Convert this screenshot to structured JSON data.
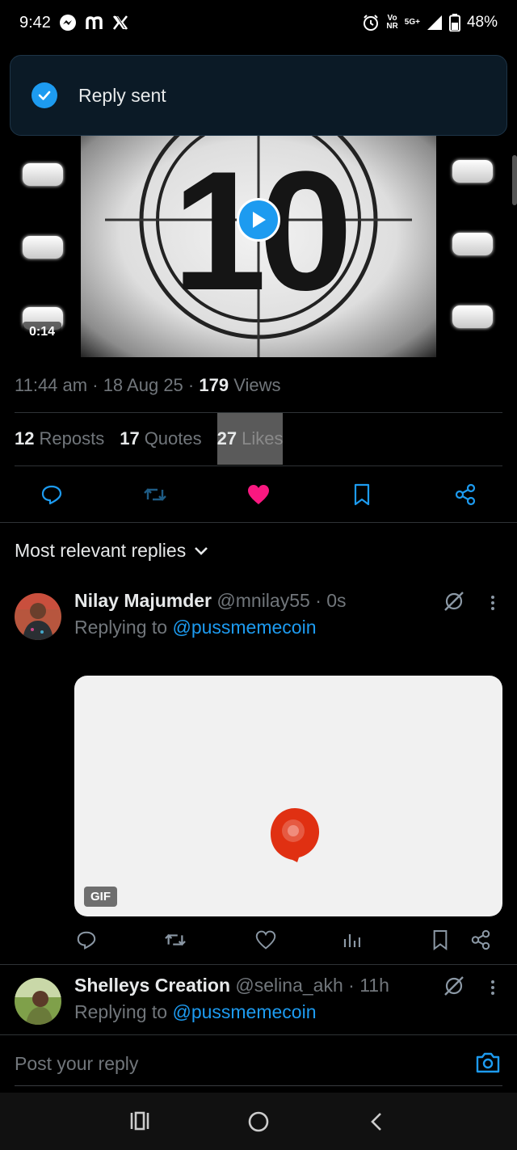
{
  "status_bar": {
    "time": "9:42",
    "battery": "48%",
    "net_top": "Vo",
    "net_bottom": "NR",
    "signal": "5G+"
  },
  "toast": {
    "text": "Reply sent"
  },
  "video": {
    "duration": "0:14",
    "countdown_digit": "10"
  },
  "post_meta": {
    "time": "11:44 am",
    "date": "18 Aug 25",
    "views_count": "179",
    "views_label": "Views",
    "separator": "·"
  },
  "stats": {
    "reposts_count": "12",
    "reposts_label": "Reposts",
    "quotes_count": "17",
    "quotes_label": "Quotes",
    "likes_count": "27",
    "likes_label": "Likes"
  },
  "sort": {
    "label": "Most relevant replies"
  },
  "replies": [
    {
      "name": "Nilay Majumder",
      "handle": "@mnilay55",
      "time": "0s",
      "replying_label": "Replying to",
      "replying_to": "@pussmemecoin",
      "media_badge": "GIF"
    },
    {
      "name": "Shelleys Creation",
      "handle": "@selina_akh",
      "time": "11h",
      "replying_label": "Replying to",
      "replying_to": "@pussmemecoin"
    }
  ],
  "compose": {
    "placeholder": "Post your reply"
  },
  "colors": {
    "accent": "#1d9bf0",
    "like": "#f91880",
    "background": "#000000",
    "muted": "#71767b"
  },
  "icons": [
    "messenger-icon",
    "m-icon",
    "x-logo-icon",
    "alarm-icon",
    "signal-icon",
    "battery-icon",
    "check-icon",
    "play-icon",
    "reply-icon",
    "repost-icon",
    "heart-icon",
    "bookmark-icon",
    "share-icon",
    "chevron-down-icon",
    "grok-icon",
    "more-icon",
    "analytics-icon",
    "camera-icon",
    "recents-icon",
    "home-icon",
    "back-icon"
  ]
}
